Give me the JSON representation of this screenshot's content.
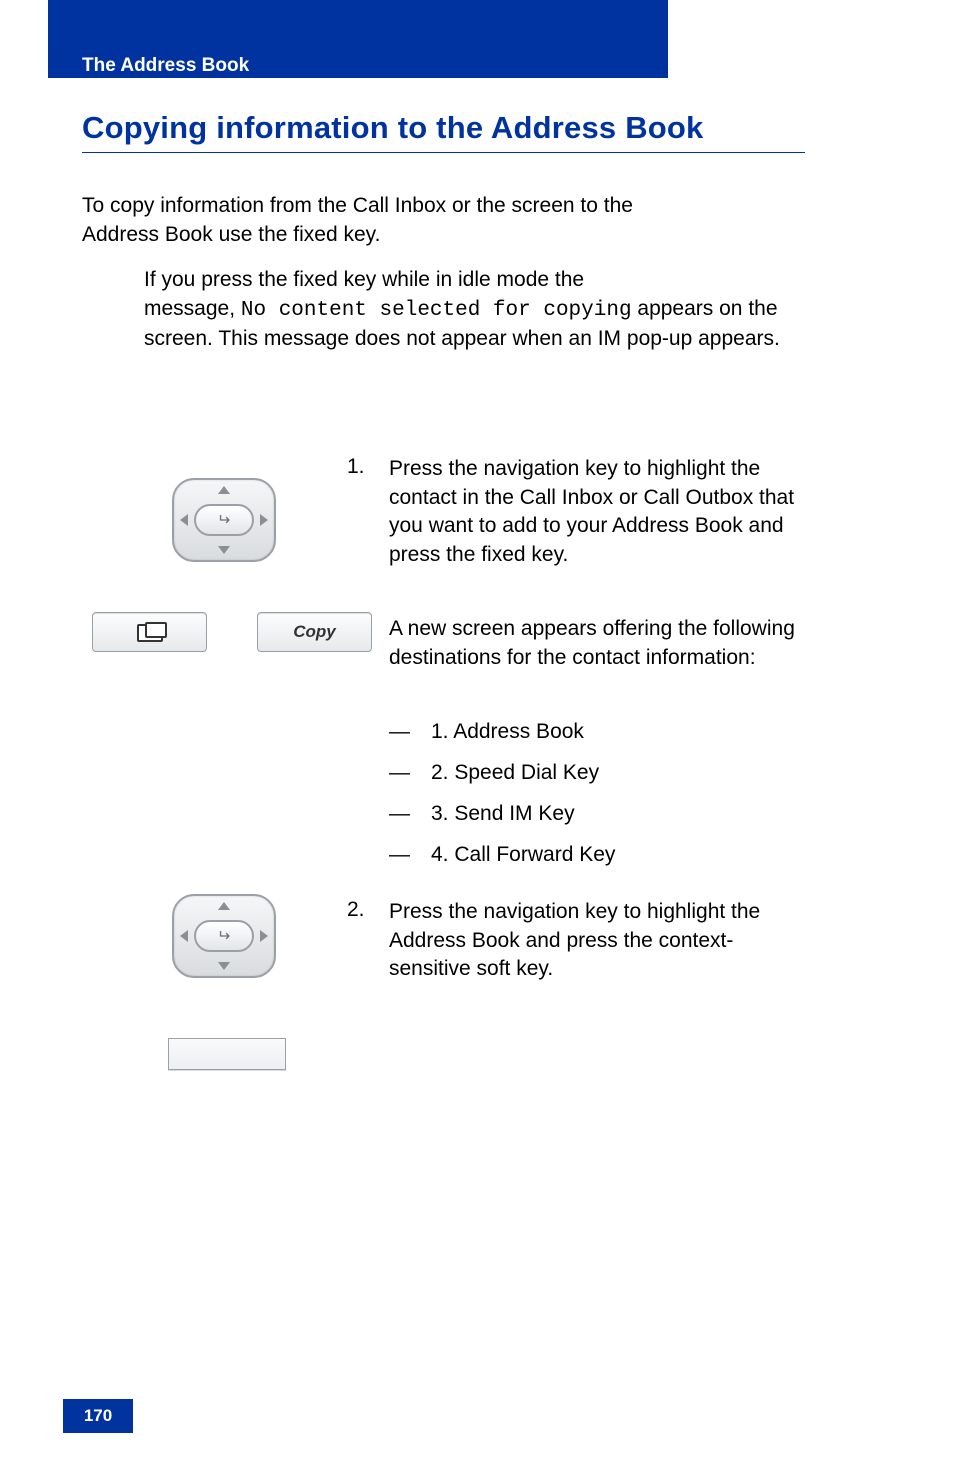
{
  "header": {
    "section_title": "The Address Book"
  },
  "title": "Copying information to the Address Book",
  "intro": {
    "line1_before": "To copy information from the Call Inbox or the ",
    "line1_after": " screen to the",
    "line2_before": "Address Book use the ",
    "line2_after": " fixed key."
  },
  "note": {
    "l1_before": "If you press the ",
    "l1_after": " fixed key while in idle mode the",
    "l2_before": "message, ",
    "l2_mono": "No content selected for copying",
    "l2_after": " appears on the",
    "l3": "screen. This message does not appear when an IM pop-up appears."
  },
  "step1": {
    "num": "1.",
    "body_a": "Press the ",
    "body_b": " navigation key to highlight the contact in the Call Inbox or Call Outbox that you want to add to your Address Book and press the ",
    "body_c": " fixed key.",
    "after": "A new screen appears offering the following destinations for the contact information:"
  },
  "destinations": {
    "dash": "—",
    "items": [
      "1. Address Book",
      "2. Speed Dial Key",
      "3. Send IM Key",
      "4. Call Forward Key"
    ]
  },
  "step2": {
    "num": "2.",
    "body_a": "Press the ",
    "body_b": " navigation key to highlight the Address Book and press the ",
    "body_c": " context-sensitive soft key."
  },
  "softkeys": {
    "copy_label": "Copy"
  },
  "page_number": "170"
}
